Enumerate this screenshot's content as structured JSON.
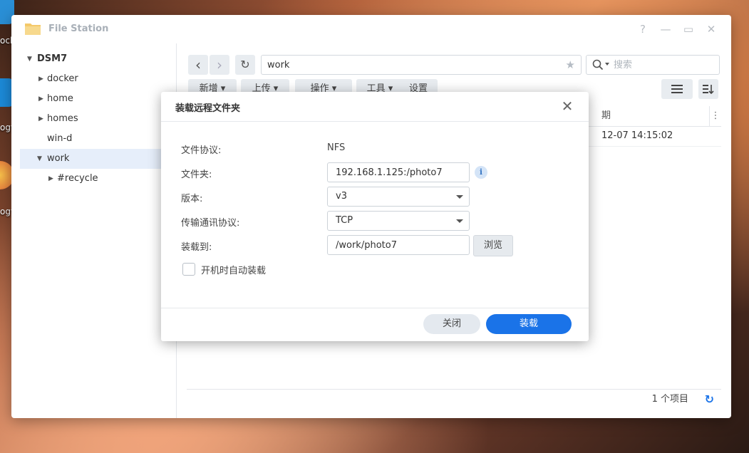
{
  "desktop": {
    "icons": [
      {
        "name": "docker-desktop-icon",
        "label": "ock",
        "color": "#2a8fd6"
      },
      {
        "name": "synology-app-desktop-icon",
        "label": "ogy",
        "color": "#1c8ad8"
      },
      {
        "name": "synology-photos-desktop-icon",
        "label": "ogy",
        "color": "#f08a3a"
      }
    ]
  },
  "window": {
    "title": "File Station",
    "controls": {
      "help": "?",
      "minimize": "—",
      "maximize": "▭",
      "close": "✕"
    }
  },
  "sidebar": {
    "root": "DSM7",
    "items": [
      {
        "label": "docker",
        "expandable": true
      },
      {
        "label": "home",
        "expandable": true
      },
      {
        "label": "homes",
        "expandable": true
      },
      {
        "label": "win-d",
        "expandable": false
      },
      {
        "label": "work",
        "expandable": true,
        "expanded": true,
        "selected": true
      },
      {
        "label": "#recycle",
        "expandable": true,
        "child": true
      }
    ]
  },
  "toolbar": {
    "back": "‹",
    "forward": "›",
    "refresh": "↻",
    "path": "work",
    "favorite": "★",
    "search_placeholder": "搜索",
    "buttons": {
      "create": "新增",
      "upload": "上传",
      "action": "操作",
      "tools": "工具",
      "settings": "设置"
    }
  },
  "list": {
    "header_date_partial": "期",
    "rows": [
      {
        "date_partial": "12-07 14:15:02"
      }
    ],
    "footer_count": "1 个项目"
  },
  "dialog": {
    "title": "装载远程文件夹",
    "close": "✕",
    "fields": {
      "protocol_label": "文件协议:",
      "protocol_value": "NFS",
      "folder_label": "文件夹:",
      "folder_value": "192.168.1.125:/photo7",
      "version_label": "版本:",
      "version_value": "v3",
      "transport_label": "传输通讯协议:",
      "transport_value": "TCP",
      "mount_to_label": "装载到:",
      "mount_to_value": "/work/photo7",
      "browse": "浏览",
      "auto_mount_label": "开机时自动装载",
      "auto_mount_checked": false
    },
    "buttons": {
      "close": "关闭",
      "mount": "装载"
    },
    "info_icon": "i",
    "accent_color": "#1a73e8"
  }
}
